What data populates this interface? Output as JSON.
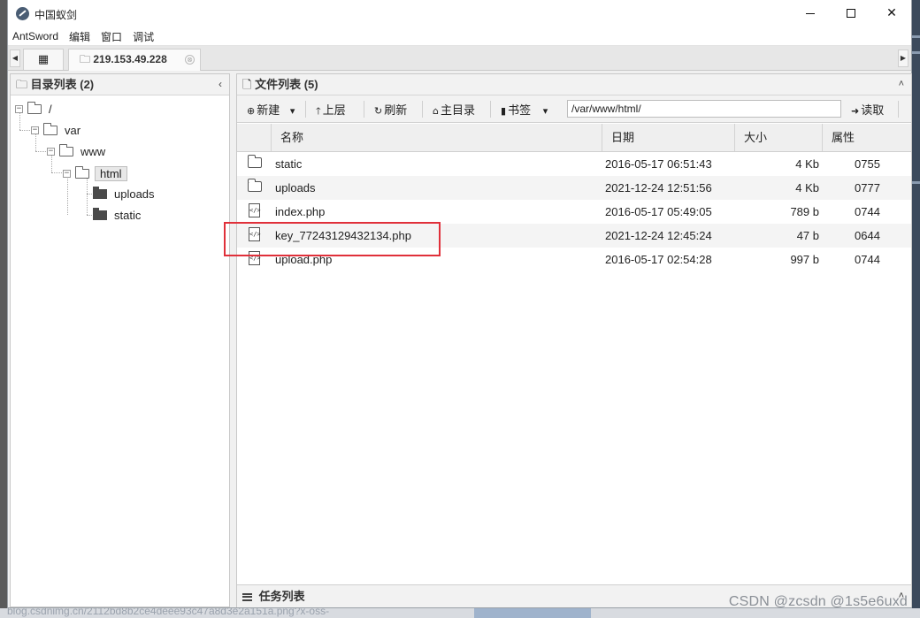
{
  "window": {
    "title": "中国蚁剑",
    "controls": {
      "minimize": "",
      "maximize": "",
      "close": "✕"
    }
  },
  "menu": [
    "AntSword",
    "编辑",
    "窗口",
    "调试"
  ],
  "tabs": {
    "home_icon": "grid-icon",
    "host": "219.153.49.228",
    "close_glyph": "⊗"
  },
  "left_panel": {
    "title": "目录列表 (2)",
    "collapse_glyph": "‹",
    "tree": [
      {
        "label": "/",
        "state": "expanded"
      },
      {
        "label": "var",
        "state": "expanded"
      },
      {
        "label": "www",
        "state": "expanded"
      },
      {
        "label": "html",
        "state": "expanded",
        "selected": true
      },
      {
        "label": "uploads",
        "state": "leaf"
      },
      {
        "label": "static",
        "state": "leaf"
      }
    ]
  },
  "right_panel": {
    "title": "文件列表 (5)",
    "collapse_glyph": "˄",
    "toolbar": {
      "new": "新建",
      "up": "上层",
      "refresh": "刷新",
      "home": "主目录",
      "bookmark": "书签",
      "path": "/var/www/html/",
      "read": "读取"
    },
    "columns": [
      "名称",
      "日期",
      "大小",
      "属性"
    ],
    "files": [
      {
        "type": "folder",
        "name": "static",
        "date": "2016-05-17 06:51:43",
        "size": "4 Kb",
        "perm": "0755"
      },
      {
        "type": "folder",
        "name": "uploads",
        "date": "2021-12-24 12:51:56",
        "size": "4 Kb",
        "perm": "0777"
      },
      {
        "type": "file",
        "name": "index.php",
        "date": "2016-05-17 05:49:05",
        "size": "789 b",
        "perm": "0744"
      },
      {
        "type": "file",
        "name": "key_77243129432134.php",
        "date": "2021-12-24 12:45:24",
        "size": "47 b",
        "perm": "0644"
      },
      {
        "type": "file",
        "name": "upload.php",
        "date": "2016-05-17 02:54:28",
        "size": "997 b",
        "perm": "0744"
      }
    ],
    "task_list": "任务列表"
  },
  "watermark": "CSDN @zcsdn @1s5e6uxd",
  "background_url": "blog.csdnimg.cn/2112bd8b2ce4deee93c47a8d3e2a151a.png?x-oss-",
  "colors": {
    "highlight": "#e0303a"
  }
}
